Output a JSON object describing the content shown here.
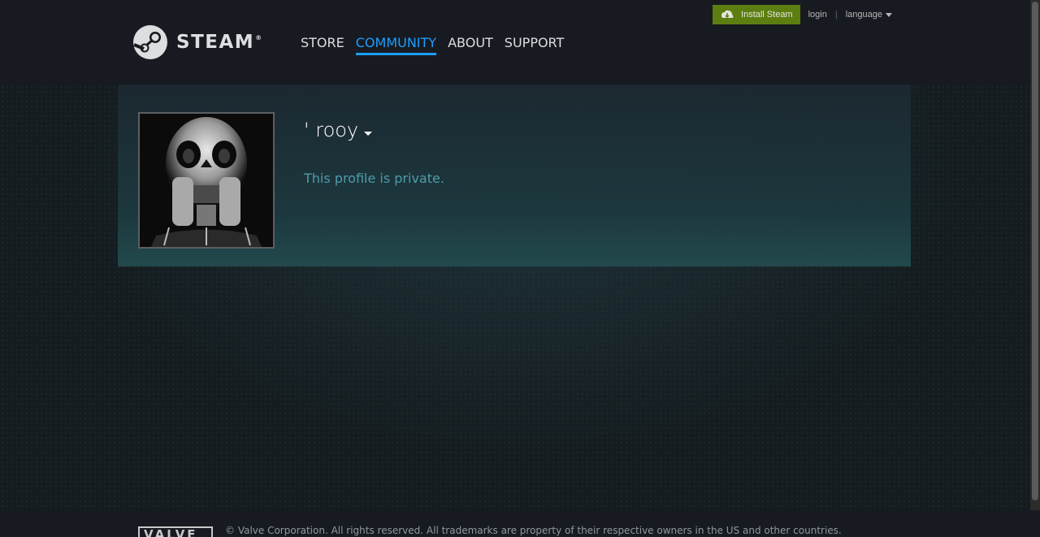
{
  "header": {
    "logo_text": "STEAM",
    "logo_reg": "®",
    "nav": [
      {
        "label": "STORE",
        "active": false
      },
      {
        "label": "COMMUNITY",
        "active": true
      },
      {
        "label": "ABOUT",
        "active": false
      },
      {
        "label": "SUPPORT",
        "active": false
      }
    ],
    "install_label": "Install Steam",
    "login_label": "login",
    "separator": "|",
    "language_label": "language"
  },
  "profile": {
    "persona_name": "' rooy",
    "private_message": "This profile is private."
  },
  "footer": {
    "valve_logo": "VALVE",
    "copyright": "© Valve Corporation. All rights reserved. All trademarks are property of their respective owners in the US and other countries."
  },
  "colors": {
    "accent": "#1a9fff",
    "install_green": "#5c7e10",
    "private_text": "#4f9bab"
  }
}
